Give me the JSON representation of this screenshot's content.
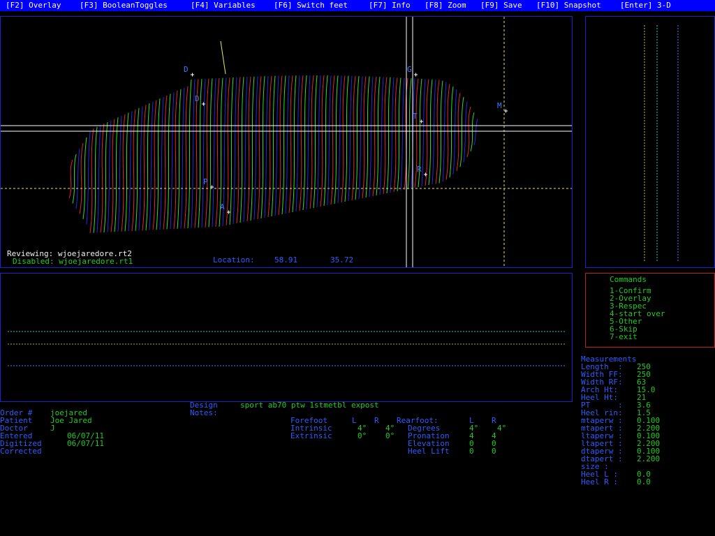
{
  "menu": [
    {
      "key": "[F2]",
      "label": "Overlay"
    },
    {
      "key": "[F3]",
      "label": "BooleanToggles"
    },
    {
      "key": "[F4]",
      "label": "Variables"
    },
    {
      "key": "[F6]",
      "label": "Switch feet"
    },
    {
      "key": "[F7]",
      "label": "Info"
    },
    {
      "key": "[F8]",
      "label": "Zoom"
    },
    {
      "key": "[F9]",
      "label": "Save"
    },
    {
      "key": "[F10]",
      "label": "Snapshot"
    },
    {
      "key": "[Enter]",
      "label": "3-D"
    }
  ],
  "viewer": {
    "reviewing_label": "Reviewing:",
    "reviewing_file": "wjoejaredore.rt2",
    "disabled_label": "Disabled:",
    "disabled_file": "wjoejaredore.rt1",
    "location_label": "Location:",
    "location_x": "58.91",
    "location_y": "35.72",
    "landmarks": [
      "D",
      "D",
      "G",
      "T",
      "M",
      "P",
      "R",
      "A"
    ]
  },
  "commands": {
    "title": "Commands",
    "items": [
      "1-Confirm",
      "2-Overlay",
      "3-Respec",
      "4-start over",
      "5-Other",
      "6-Skip",
      "7-exit"
    ]
  },
  "measurements": {
    "title": "Measurements",
    "rows": [
      {
        "label": "Length  :",
        "value": "250"
      },
      {
        "label": "Width FF:",
        "value": "250"
      },
      {
        "label": "Width RF:",
        "value": "63"
      },
      {
        "label": "Arch Ht:",
        "value": "15.0"
      },
      {
        "label": "Heel Ht:",
        "value": "21"
      },
      {
        "label": "PT      :",
        "value": "3.6"
      },
      {
        "label": "Heel rin:",
        "value": "1.5"
      },
      {
        "label": "mtaperw :",
        "value": "0.100"
      },
      {
        "label": "mtapert :",
        "value": "2.200"
      },
      {
        "label": "ltaperw :",
        "value": "0.100"
      },
      {
        "label": "ltapert :",
        "value": "2.200"
      },
      {
        "label": "dtaperw :",
        "value": "0.100"
      },
      {
        "label": "dtapert :",
        "value": "2.200"
      },
      {
        "label": "size :",
        "value": ""
      },
      {
        "label": "Heel L :",
        "value": "0.0"
      },
      {
        "label": "Heel R :",
        "value": "0.0"
      }
    ]
  },
  "order": {
    "rows": [
      {
        "label": "Order #",
        "value": "joejared"
      },
      {
        "label": "Patient",
        "value": "Joe Jared"
      },
      {
        "label": "Doctor",
        "value": "J"
      },
      {
        "label": "Entered",
        "value": "06/07/11"
      },
      {
        "label": "Digitized",
        "value": "06/07/11"
      },
      {
        "label": "Corrected",
        "value": ""
      }
    ]
  },
  "design": {
    "label": "Design",
    "value": "sport ab70 ptw 1stmetbl expost",
    "notes_label": "Notes:"
  },
  "forefoot": {
    "title": "Forefoot",
    "col_l": "L",
    "col_r": "R",
    "rows": [
      {
        "label": "Intrinsic",
        "l": "4°",
        "r": "4°"
      },
      {
        "label": "Extrinsic",
        "l": "0°",
        "r": "0°"
      }
    ]
  },
  "rearfoot": {
    "title": "Rearfoot:",
    "col_l": "L",
    "col_r": "R",
    "rows": [
      {
        "label": "Degrees",
        "l": "4°",
        "r": "4°"
      },
      {
        "label": "Pronation",
        "l": "4",
        "r": "4"
      },
      {
        "label": "Elevation",
        "l": "0",
        "r": "0"
      },
      {
        "label": "Heel Lift",
        "l": "0",
        "r": "0"
      }
    ]
  },
  "colors": {
    "menu_bg": "#0000ff",
    "panel_border": "#2020d0",
    "command_border": "#c02020",
    "label_blue": "#2d5cff",
    "value_green": "#22c922",
    "scan_red": "#e02828",
    "scan_green": "#28e028",
    "scan_blue": "#2828e0"
  }
}
